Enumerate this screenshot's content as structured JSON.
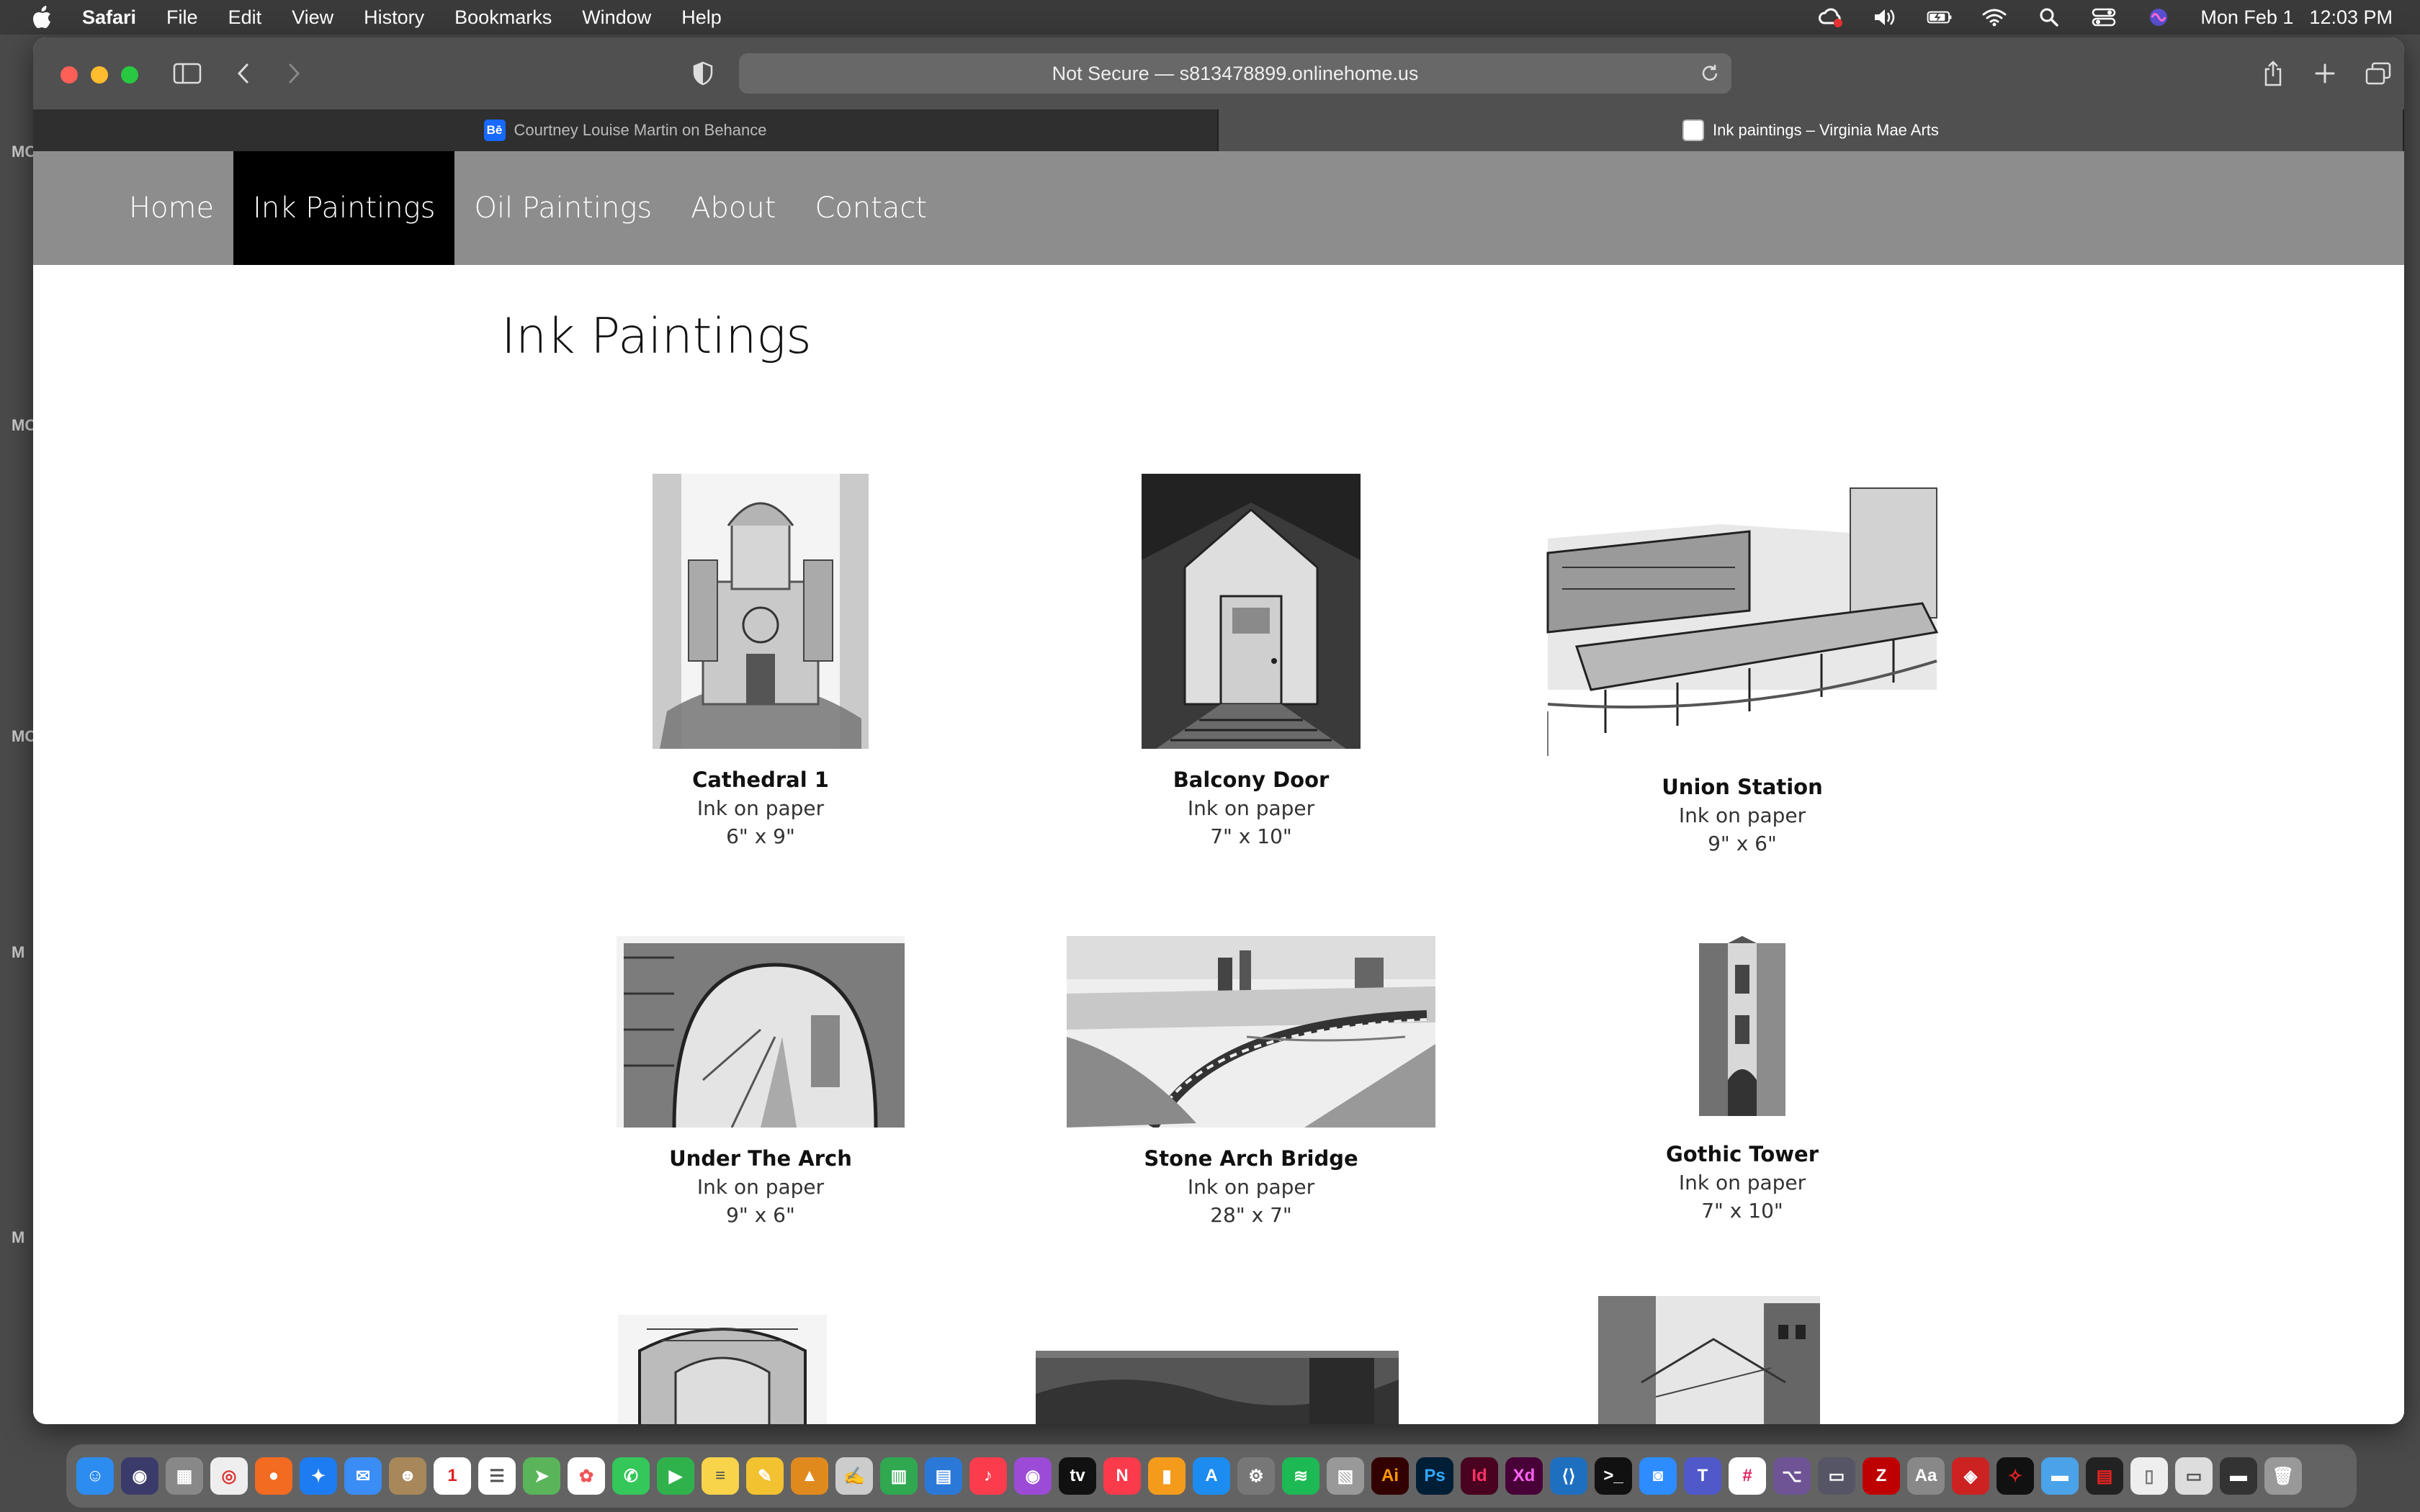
{
  "menubar": {
    "apple": "apple-icon",
    "app_name": "Safari",
    "items": [
      "File",
      "Edit",
      "View",
      "History",
      "Bookmarks",
      "Window",
      "Help"
    ],
    "date": "Mon Feb 1",
    "time": "12:03 PM"
  },
  "browser": {
    "address": "Not Secure — s813478899.onlinehome.us",
    "tabs": [
      {
        "label": "Courtney Louise Martin on Behance",
        "favicon": "Bē"
      },
      {
        "label": "Ink paintings – Virginia Mae Arts",
        "favicon": ""
      }
    ]
  },
  "site": {
    "nav": [
      "Home",
      "Ink Paintings",
      "Oil Paintings",
      "About",
      "Contact"
    ],
    "active_nav": "Ink Paintings",
    "page_title": "Ink Paintings"
  },
  "paintings": [
    {
      "title": "Cathedral 1",
      "medium": "Ink on paper",
      "size": "6\" x 9\""
    },
    {
      "title": "Balcony Door",
      "medium": "Ink on paper",
      "size": "7\" x 10\""
    },
    {
      "title": "Union Station",
      "medium": "Ink on paper",
      "size": "9\" x 6\""
    },
    {
      "title": "Under The Arch",
      "medium": "Ink on paper",
      "size": "9\" x 6\""
    },
    {
      "title": "Stone Arch Bridge",
      "medium": "Ink on paper",
      "size": "28\" x 7\""
    },
    {
      "title": "Gothic Tower",
      "medium": "Ink on paper",
      "size": "7\" x 10\""
    }
  ],
  "desktop_edge_labels": [
    "MC",
    "MC",
    "MC",
    "M",
    "M"
  ]
}
